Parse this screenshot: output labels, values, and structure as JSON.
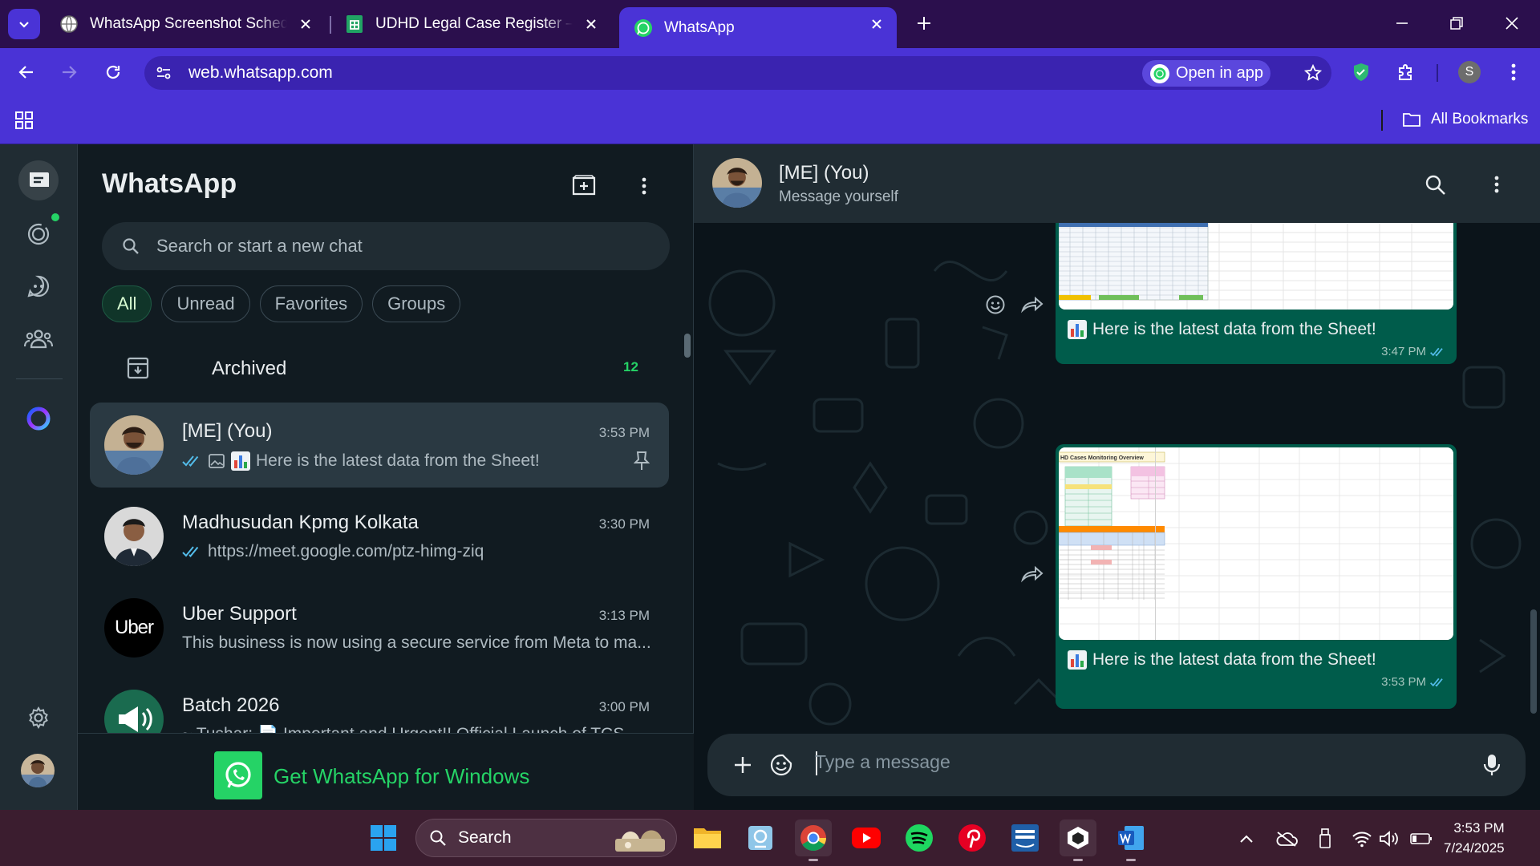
{
  "browser": {
    "tabs": [
      {
        "label": "WhatsApp Screenshot Schedule",
        "icon": "globe-icon"
      },
      {
        "label": "UDHD Legal Case Register – Off",
        "icon": "sheets-icon"
      },
      {
        "label": "WhatsApp",
        "icon": "whatsapp-icon",
        "active": true
      }
    ],
    "url": "web.whatsapp.com",
    "open_in_app": "Open in app",
    "profile_initial": "S",
    "all_bookmarks": "All Bookmarks",
    "accent": "#4a33d6"
  },
  "whatsapp": {
    "title": "WhatsApp",
    "search_placeholder": "Search or start a new chat",
    "filters": [
      "All",
      "Unread",
      "Favorites",
      "Groups"
    ],
    "active_filter": "All",
    "archived_label": "Archived",
    "archived_count": "12",
    "chats": [
      {
        "name": "[ME] (You)",
        "time": "3:53 PM",
        "preview": "Here is the latest data from the Sheet!",
        "ticks": "read",
        "pinned": true,
        "selected": true
      },
      {
        "name": "Madhusudan Kpmg Kolkata",
        "time": "3:30 PM",
        "preview": "https://meet.google.com/ptz-himg-ziq",
        "ticks": "read"
      },
      {
        "name": "Uber Support",
        "time": "3:13 PM",
        "preview": "This business is now using a secure service from Meta to ma...",
        "avatar_text": "Uber"
      },
      {
        "name": "Batch 2026",
        "time": "3:00 PM",
        "preview": "~ Tushar: 📄 Important and Urgent!! Official Launch of TCS"
      }
    ],
    "get_windows": "Get WhatsApp for Windows",
    "brand_green": "#25d366"
  },
  "conversation": {
    "name": "[ME] (You)",
    "subtitle": "Message yourself",
    "messages": [
      {
        "caption": "Here is the latest data from the Sheet!",
        "time": "3:47 PM",
        "status": "read"
      },
      {
        "caption": "Here is the latest data from the Sheet!",
        "time": "3:53 PM",
        "status": "read",
        "sheet_title": "HD Cases Monitoring Overview"
      }
    ],
    "composer_placeholder": "Type a message",
    "bubble_color": "#005c4b"
  },
  "taskbar": {
    "search_label": "Search",
    "time": "3:53 PM",
    "date": "7/24/2025",
    "apps": [
      "windows-start",
      "file-explorer",
      "remote-desktop",
      "chrome",
      "youtube",
      "spotify",
      "pinterest",
      "prime-video",
      "terminal",
      "word"
    ]
  }
}
